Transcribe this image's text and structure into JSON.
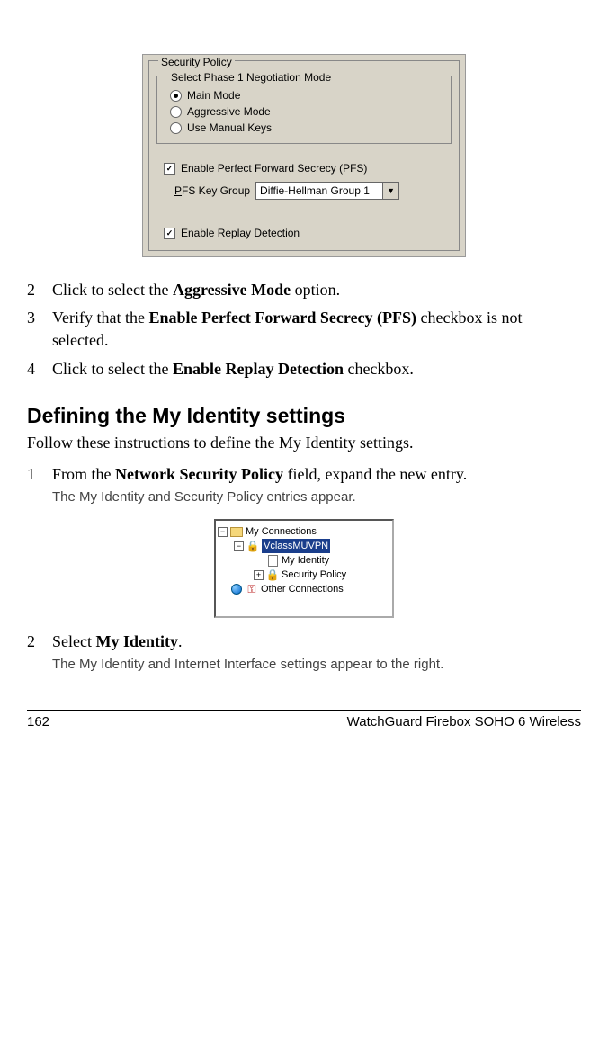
{
  "panel": {
    "outer_legend": "Security Policy",
    "inner_legend": "Select Phase 1 Negotiation Mode",
    "radios": {
      "main": "Main Mode",
      "aggressive": "Aggressive Mode",
      "manual": "Use Manual Keys"
    },
    "pfs_checkbox_label": "Enable Perfect Forward Secrecy (PFS)",
    "pfs_key_prefix": "P",
    "pfs_key_rest": "FS Key Group",
    "pfs_dropdown_value": "Diffie-Hellman Group 1",
    "replay_checkbox_label": "Enable Replay Detection"
  },
  "steps_a": {
    "s2": {
      "num": "2",
      "pre": "Click to select the ",
      "bold": "Aggressive Mode",
      "post": " option."
    },
    "s3": {
      "num": "3",
      "pre": "Verify that the ",
      "bold": "Enable Perfect Forward Secrecy (PFS)",
      "post": " checkbox is not selected."
    },
    "s4": {
      "num": "4",
      "pre": "Click to select the ",
      "bold": "Enable Replay Detection",
      "post": " checkbox."
    }
  },
  "section_heading": "Defining the My Identity settings",
  "section_intro": "Follow these instructions to define the My Identity settings.",
  "steps_b": {
    "s1": {
      "num": "1",
      "pre": "From the ",
      "bold": "Network Security Policy",
      "post": " field, expand the new entry.",
      "note": "The My Identity and Security Policy entries appear."
    },
    "s2": {
      "num": "2",
      "pre": "Select ",
      "bold": "My Identity",
      "post": ".",
      "note": "The My Identity and Internet Interface settings appear to the right."
    }
  },
  "tree": {
    "root": "My Connections",
    "conn": "VclassMUVPN",
    "identity": "My Identity",
    "secpol": "Security Policy",
    "other": "Other Connections"
  },
  "footer": {
    "page": "162",
    "product": "WatchGuard Firebox SOHO 6 Wireless"
  }
}
